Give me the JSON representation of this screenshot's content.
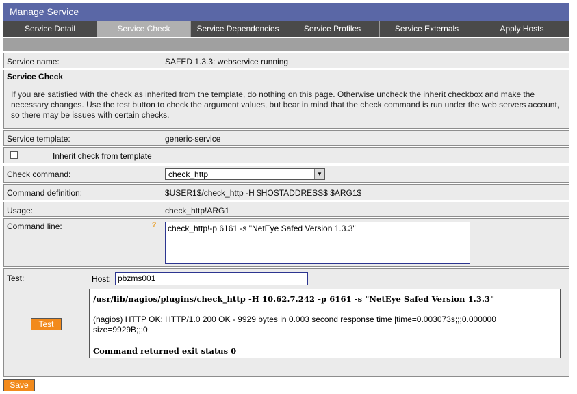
{
  "app": {
    "title": "Manage Service"
  },
  "tabs": [
    {
      "label": "Service Detail"
    },
    {
      "label": "Service Check"
    },
    {
      "label": "Service Dependencies"
    },
    {
      "label": "Service Profiles"
    },
    {
      "label": "Service Externals"
    },
    {
      "label": "Apply Hosts"
    }
  ],
  "service_name": {
    "label": "Service name:",
    "value": "SAFED 1.3.3: webservice running"
  },
  "service_check": {
    "title": "Service Check",
    "description": "If you are satisfied with the check as inherited from the template, do nothing on this page. Otherwise uncheck the inherit checkbox and make the necessary changes. Use the test button to check the argument values, but bear in mind that the check command is run under the web servers account, so there may be issues with certain checks."
  },
  "service_template": {
    "label": "Service template:",
    "value": "generic-service"
  },
  "inherit": {
    "label": "Inherit check from template",
    "checked": false
  },
  "check_command": {
    "label": "Check command:",
    "selected": "check_http"
  },
  "command_definition": {
    "label": "Command definition:",
    "value": "$USER1$/check_http -H $HOSTADDRESS$ $ARG1$"
  },
  "usage": {
    "label": "Usage:",
    "value": "check_http!ARG1"
  },
  "command_line": {
    "label": "Command line:",
    "help": "?",
    "value": "check_http!-p 6161 -s \"NetEye Safed Version 1.3.3\""
  },
  "test": {
    "label": "Test:",
    "host_label": "Host:",
    "host_value": "pbzms001",
    "button_label": "Test",
    "output_command": "/usr/lib/nagios/plugins/check_http -H 10.62.7.242 -p 6161 -s \"NetEye Safed Version 1.3.3\"",
    "output_result": "(nagios) HTTP OK: HTTP/1.0 200 OK - 9929 bytes in 0.003 second response time |time=0.003073s;;;0.000000 size=9929B;;;0",
    "output_exit": "Command returned exit status 0"
  },
  "save_label": "Save",
  "colors": {
    "header": "#5a67a6",
    "tab_bg": "#4a4a4a",
    "tab_active": "#b0b0b0",
    "button": "#f28a1c"
  }
}
